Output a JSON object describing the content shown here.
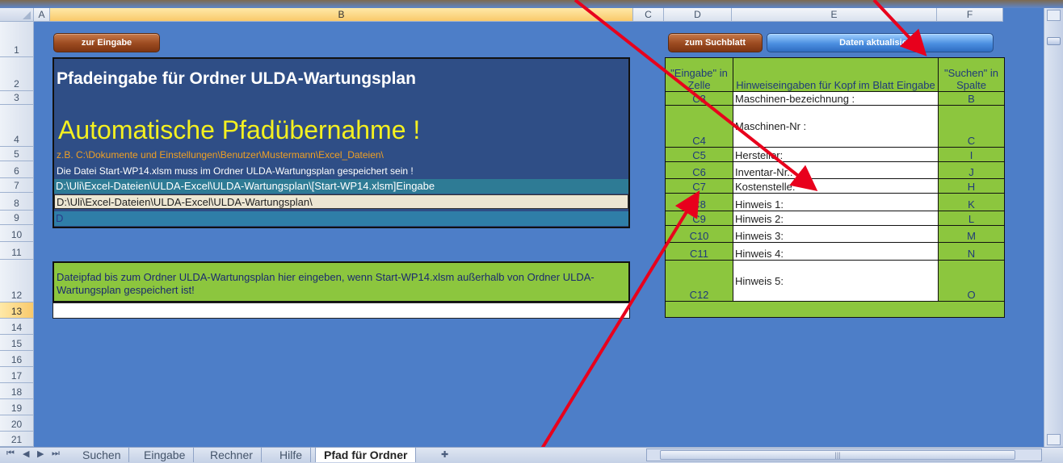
{
  "columns": [
    "A",
    "B",
    "C",
    "D",
    "E",
    "F"
  ],
  "rows": [
    "1",
    "2",
    "3",
    "4",
    "5",
    "6",
    "7",
    "8",
    "9",
    "10",
    "11",
    "12",
    "13",
    "14",
    "15",
    "16",
    "17",
    "18",
    "19",
    "20",
    "21"
  ],
  "buttons": {
    "zur_eingabe": "zur Eingabe",
    "zum_suchblatt": "zum Suchblatt",
    "daten_aktualisieren": "Daten aktualisieren"
  },
  "panel": {
    "title": "Pfadeingabe für Ordner ULDA-Wartungsplan",
    "headline": "Automatische Pfadübernahme !",
    "example": "z.B.  C:\\Dokumente und Einstellungen\\Benutzer\\Mustermann\\Excel_Dateien\\",
    "note": "Die Datei Start-WP14.xlsm muss im Ordner ULDA-Wartungsplan gespeichert sein !",
    "row7": "D:\\Uli\\Excel-Dateien\\ULDA-Excel\\ULDA-Wartungsplan\\[Start-WP14.xlsm]Eingabe",
    "row8": "D:\\Uli\\Excel-Dateien\\ULDA-Excel\\ULDA-Wartungsplan\\",
    "row9": "D"
  },
  "instruction": "Dateipfad bis zum Ordner ULDA-Wartungsplan hier eingeben, wenn Start-WP14.xlsm außerhalb von Ordner ULDA-Wartungsplan gespeichert ist!",
  "path_input_value": "",
  "table": {
    "header_col1": "\"Eingabe\" in Zelle",
    "header_col2": "Hinweiseingaben für Kopf im Blatt Eingabe",
    "header_col3": "\"Suchen\" in Spalte",
    "rows": [
      {
        "cell": "C3",
        "label": "Maschinen-bezeichnung :",
        "col": "B"
      },
      {
        "cell": "C4",
        "label": "Maschinen-Nr :",
        "col": "C"
      },
      {
        "cell": "C5",
        "label": "Hersteller:",
        "col": "I"
      },
      {
        "cell": "C6",
        "label": "Inventar-Nr.:",
        "col": "J"
      },
      {
        "cell": "C7",
        "label": "Kostenstelle:",
        "col": "H"
      },
      {
        "cell": "C8",
        "label": "Hinweis 1:",
        "col": "K"
      },
      {
        "cell": "C9",
        "label": "Hinweis 2:",
        "col": "L"
      },
      {
        "cell": "C10",
        "label": "Hinweis 3:",
        "col": "M"
      },
      {
        "cell": "C11",
        "label": "Hinweis 4:",
        "col": "N"
      },
      {
        "cell": "C12",
        "label": "Hinweis 5:",
        "col": "O"
      }
    ]
  },
  "sheet_tabs": [
    "Suchen",
    "Eingabe",
    "Rechner",
    "Hilfe",
    "Pfad für Ordner"
  ],
  "active_tab": "Pfad für Ordner",
  "colors": {
    "accent_arrow": "#e8001c",
    "panel": "#2f4e86",
    "green": "#8cc63e"
  }
}
